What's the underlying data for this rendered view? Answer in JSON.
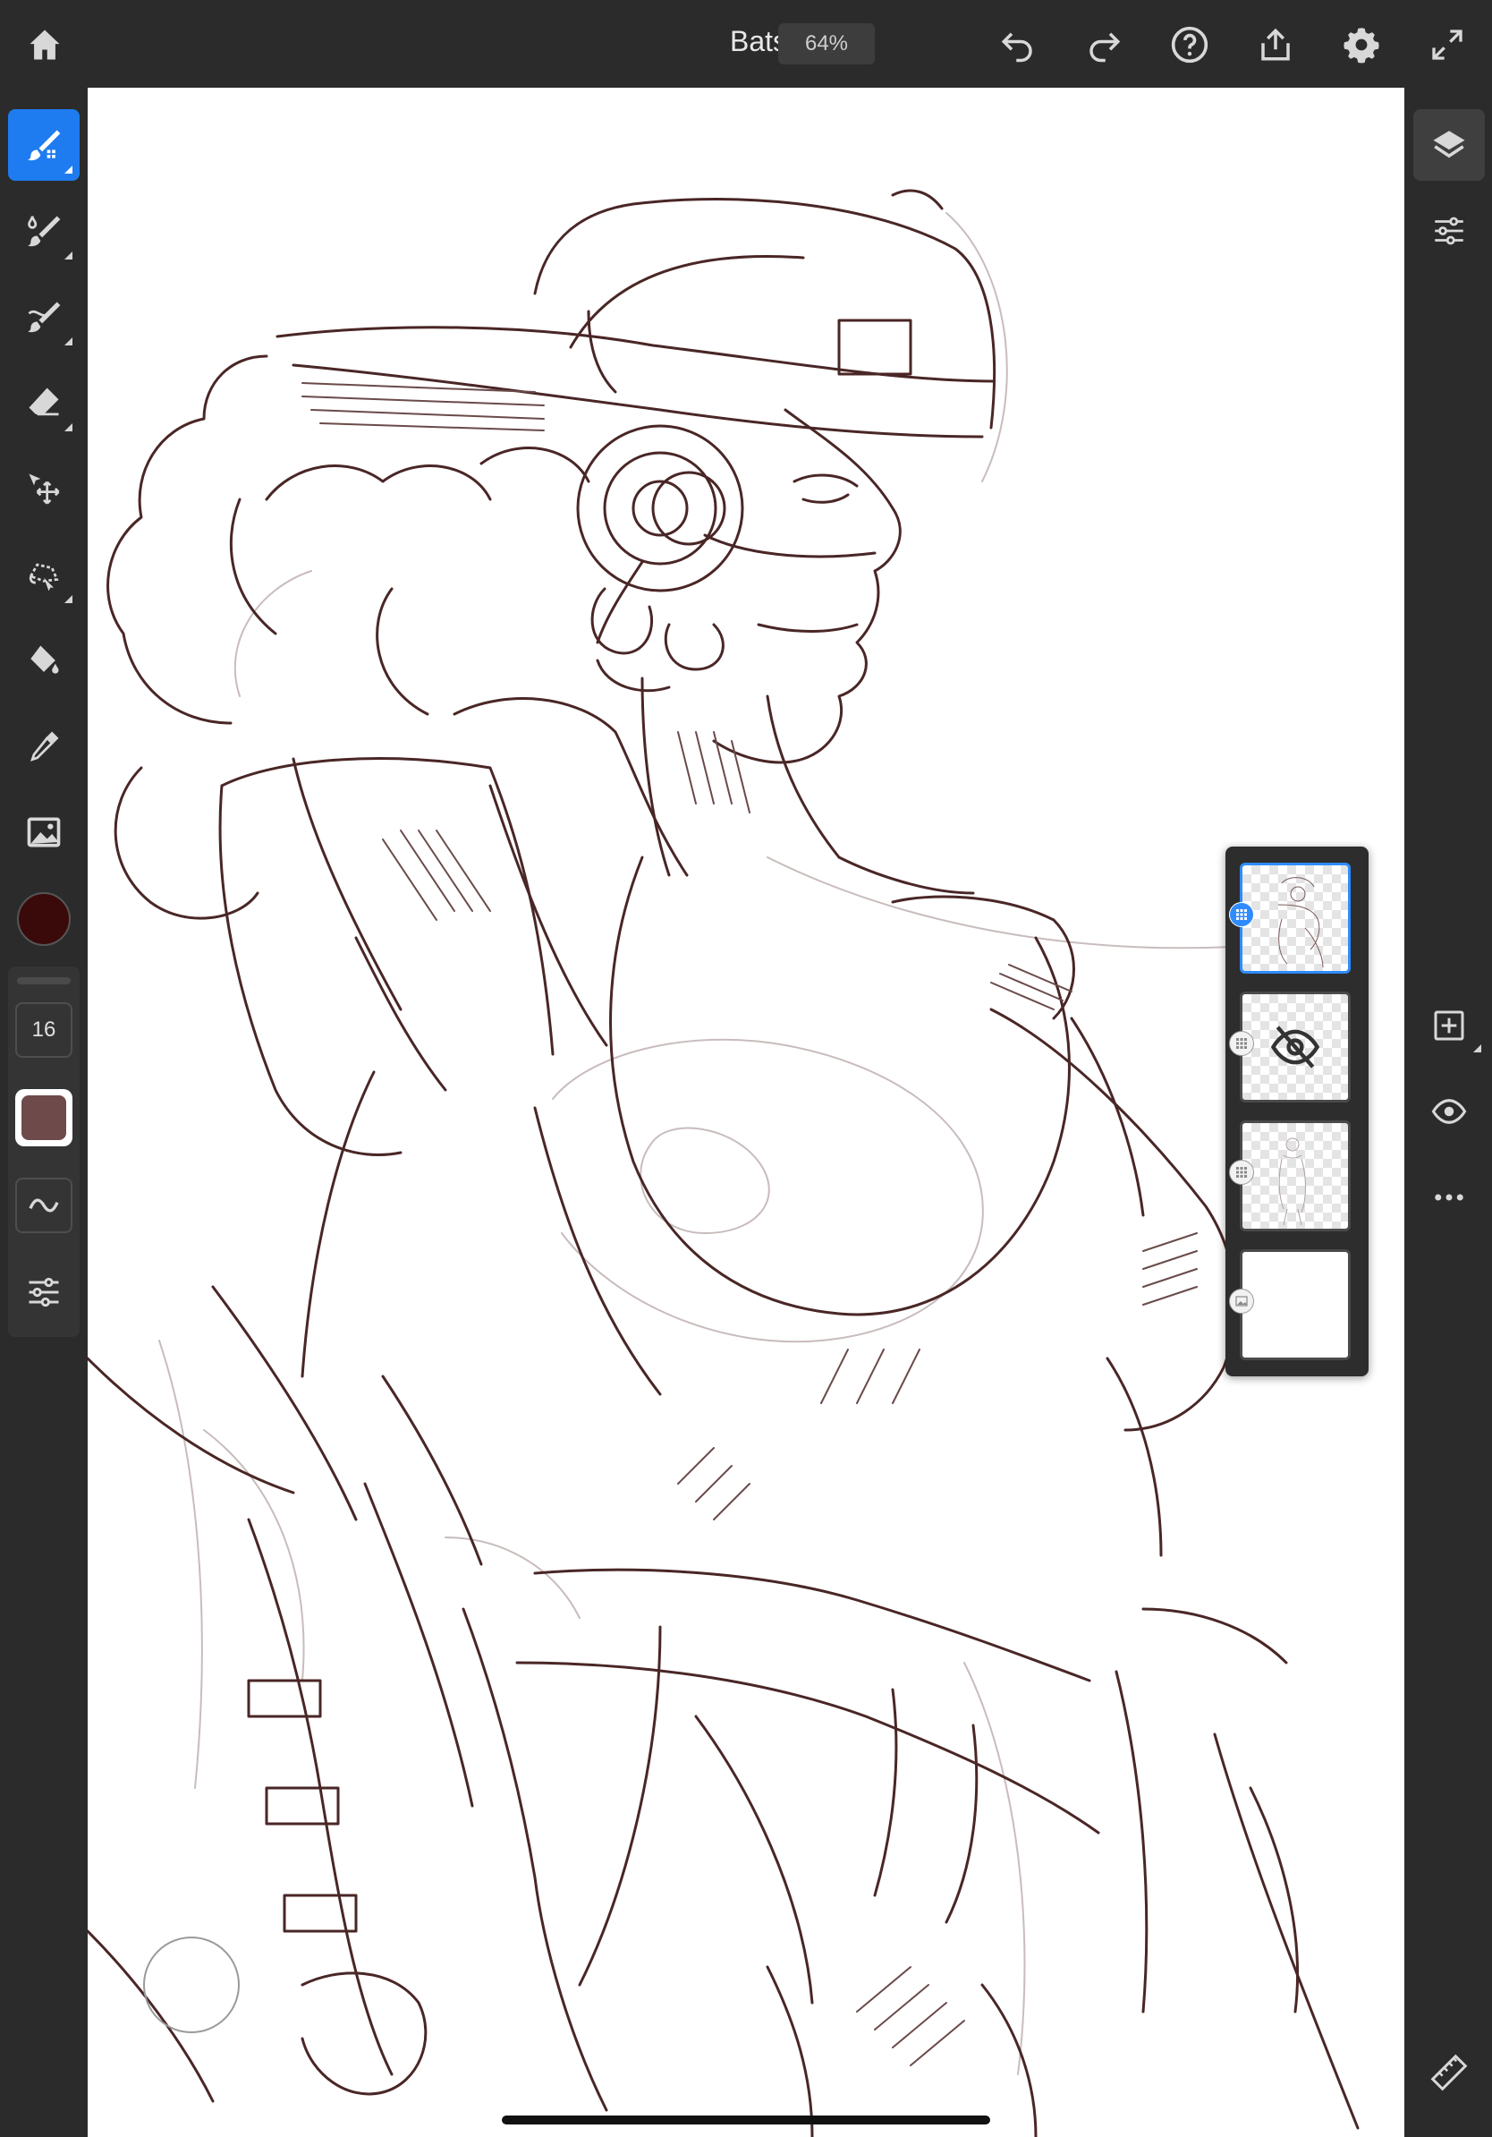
{
  "header": {
    "document_title": "Bats",
    "zoom_level": "64%",
    "icons": [
      "home-icon",
      "undo-icon",
      "redo-icon",
      "help-icon",
      "share-icon",
      "settings-icon",
      "fullscreen-icon"
    ]
  },
  "left_toolbar": {
    "tools": [
      "pixel-brush-icon",
      "live-brush-icon",
      "vector-brush-icon",
      "eraser-icon",
      "transform-icon",
      "lasso-icon",
      "fill-icon",
      "eyedropper-icon",
      "place-image-icon"
    ],
    "active_tool": "pixel-brush-icon",
    "current_color": "#3a0a0a",
    "brush_size": "16",
    "brush_opacity_swatch": "#6e4a4a",
    "smoothing_icon": "smoothing-icon",
    "brush_settings_icon": "brush-settings-icon"
  },
  "right_toolbar": {
    "icons": [
      "layers-icon",
      "layer-properties-icon",
      "add-layer-icon",
      "visibility-eye-icon",
      "more-options-icon",
      "ruler-icon"
    ]
  },
  "layers": [
    {
      "type": "pixel",
      "visible": true,
      "selected": true,
      "badge": "pixel-layer-icon"
    },
    {
      "type": "pixel",
      "visible": false,
      "selected": false,
      "badge": "pixel-layer-icon"
    },
    {
      "type": "pixel",
      "visible": true,
      "selected": false,
      "badge": "pixel-layer-icon"
    },
    {
      "type": "image",
      "visible": true,
      "selected": false,
      "badge": "image-layer-icon"
    }
  ],
  "canvas": {
    "stroke_color": "#4a2626",
    "guide_color": "#c9bcbc"
  }
}
